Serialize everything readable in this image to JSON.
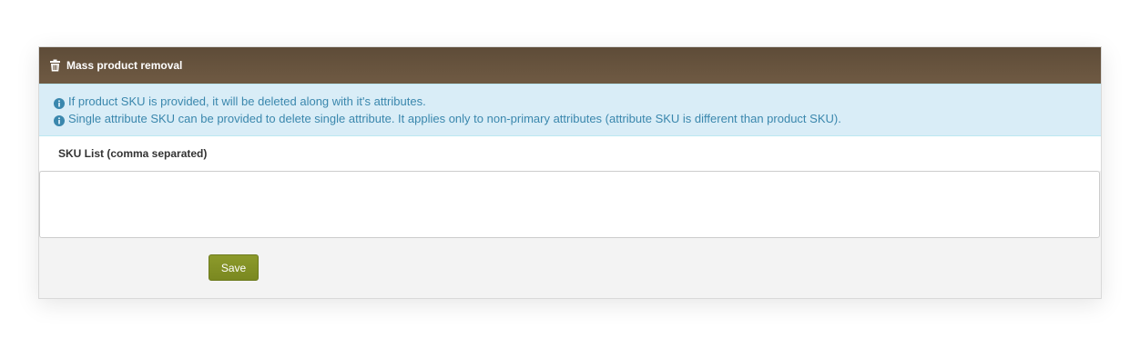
{
  "panel": {
    "title": "Mass product removal",
    "title_icon": "trash-icon"
  },
  "info": {
    "icon": "info-circle-icon",
    "lines": [
      "If product SKU is provided, it will be deleted along with it's attributes.",
      "Single attribute SKU can be provided to delete single attribute. It applies only to non-primary attributes (attribute SKU is different than product SKU)."
    ]
  },
  "form": {
    "sku_label": "SKU List (comma separated)",
    "sku_value": "",
    "save_label": "Save"
  },
  "colors": {
    "header_bg": "#5e4c38",
    "info_bg": "#d9edf7",
    "info_text": "#3a87ad",
    "save_button_bg": "#849226"
  }
}
